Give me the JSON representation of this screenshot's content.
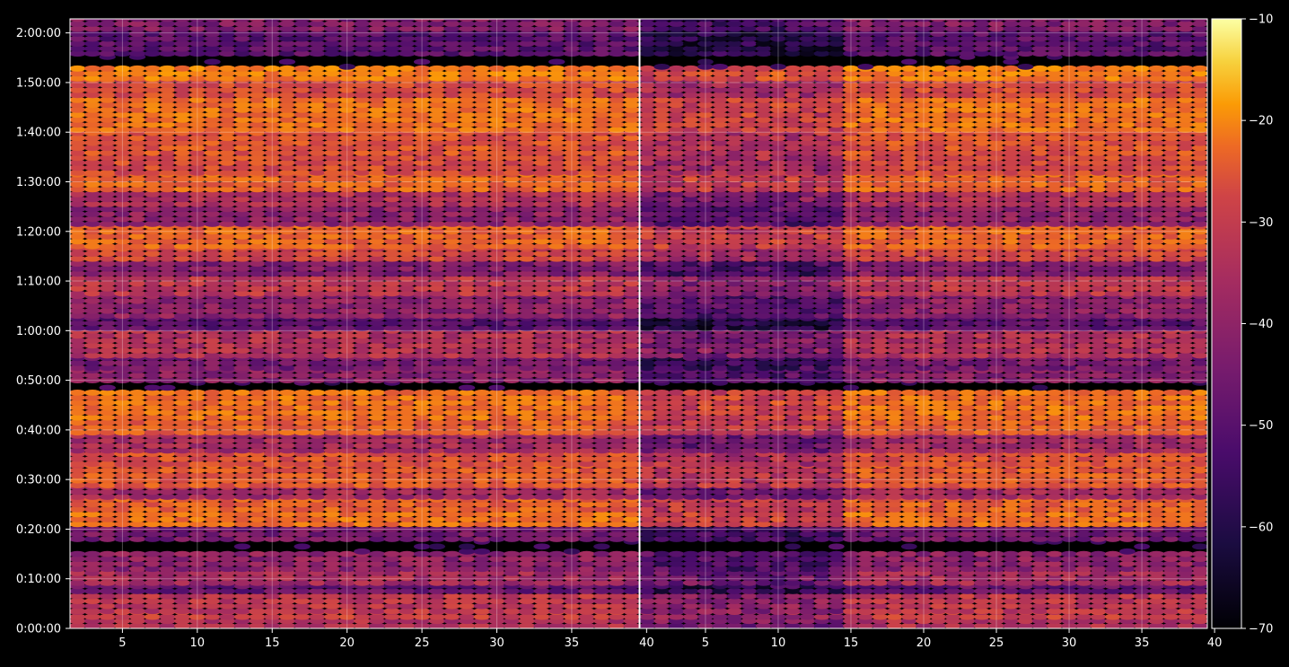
{
  "chart_data": {
    "type": "heatmap",
    "title": "",
    "xlabel": "",
    "ylabel": "",
    "panels": [
      {
        "name": "",
        "xlim": [
          1.5,
          39.5
        ],
        "x_ticks": [
          5,
          10,
          15,
          20,
          25,
          30,
          35,
          40
        ]
      },
      {
        "name": "",
        "xlim": [
          0.5,
          39.5
        ],
        "x_ticks": [
          5,
          10,
          15,
          20,
          25,
          30,
          35,
          40
        ]
      }
    ],
    "y_unit": "seconds",
    "ylim": [
      0,
      7370
    ],
    "y_ticks": [
      {
        "value": 0,
        "label": "0:00:00"
      },
      {
        "value": 600,
        "label": "0:10:00"
      },
      {
        "value": 1200,
        "label": "0:20:00"
      },
      {
        "value": 1800,
        "label": "0:30:00"
      },
      {
        "value": 2400,
        "label": "0:40:00"
      },
      {
        "value": 3000,
        "label": "0:50:00"
      },
      {
        "value": 3600,
        "label": "1:00:00"
      },
      {
        "value": 4200,
        "label": "1:10:00"
      },
      {
        "value": 4800,
        "label": "1:20:00"
      },
      {
        "value": 5400,
        "label": "1:30:00"
      },
      {
        "value": 6000,
        "label": "1:40:00"
      },
      {
        "value": 6600,
        "label": "1:50:00"
      },
      {
        "value": 7200,
        "label": "2:00:00"
      }
    ],
    "colorbar": {
      "colormap": "inferno",
      "range": [
        -70,
        -10
      ],
      "ticks": [
        -10,
        -20,
        -30,
        -40,
        -50,
        -60,
        -70
      ],
      "tick_labels": [
        "−10",
        "−20",
        "−30",
        "−40",
        "−50",
        "−60",
        "−70"
      ]
    },
    "grid": true,
    "row_bands": [
      {
        "y": [
          0,
          110
        ],
        "level": -38
      },
      {
        "y": [
          110,
          180
        ],
        "level": -34
      },
      {
        "y": [
          180,
          420
        ],
        "level": -36
      },
      {
        "y": [
          420,
          520
        ],
        "level": -50
      },
      {
        "y": [
          520,
          690
        ],
        "level": -40
      },
      {
        "y": [
          690,
          900
        ],
        "level": -44
      },
      {
        "y": [
          900,
          1050
        ],
        "level": -70
      },
      {
        "y": [
          1050,
          1230
        ],
        "level": -48
      },
      {
        "y": [
          1230,
          1410
        ],
        "level": -24
      },
      {
        "y": [
          1410,
          1560
        ],
        "level": -27
      },
      {
        "y": [
          1560,
          1700
        ],
        "level": -40
      },
      {
        "y": [
          1700,
          1960
        ],
        "level": -28
      },
      {
        "y": [
          1960,
          2120
        ],
        "level": -30
      },
      {
        "y": [
          2120,
          2340
        ],
        "level": -40
      },
      {
        "y": [
          2340,
          2520
        ],
        "level": -27
      },
      {
        "y": [
          2520,
          2880
        ],
        "level": -24
      },
      {
        "y": [
          2880,
          2970
        ],
        "level": -70
      },
      {
        "y": [
          2970,
          3120
        ],
        "level": -45
      },
      {
        "y": [
          3120,
          3270
        ],
        "level": -48
      },
      {
        "y": [
          3270,
          3600
        ],
        "level": -38
      },
      {
        "y": [
          3600,
          3750
        ],
        "level": -52
      },
      {
        "y": [
          3750,
          4020
        ],
        "level": -44
      },
      {
        "y": [
          4020,
          4260
        ],
        "level": -36
      },
      {
        "y": [
          4260,
          4440
        ],
        "level": -46
      },
      {
        "y": [
          4440,
          4590
        ],
        "level": -32
      },
      {
        "y": [
          4590,
          4860
        ],
        "level": -26
      },
      {
        "y": [
          4860,
          5100
        ],
        "level": -44
      },
      {
        "y": [
          5100,
          5280
        ],
        "level": -38
      },
      {
        "y": [
          5280,
          5480
        ],
        "level": -26
      },
      {
        "y": [
          5480,
          5720
        ],
        "level": -31
      },
      {
        "y": [
          5720,
          6000
        ],
        "level": -29
      },
      {
        "y": [
          6000,
          6420
        ],
        "level": -24
      },
      {
        "y": [
          6420,
          6620
        ],
        "level": -31
      },
      {
        "y": [
          6620,
          6760
        ],
        "level": -22
      },
      {
        "y": [
          6760,
          6920
        ],
        "level": -70
      },
      {
        "y": [
          6920,
          7220
        ],
        "level": -52
      },
      {
        "y": [
          7220,
          7370
        ],
        "level": -46
      }
    ]
  }
}
